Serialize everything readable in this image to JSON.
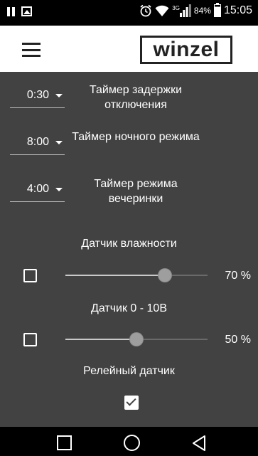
{
  "status_bar": {
    "signal_label": "3G",
    "battery": "84%",
    "time": "15:05",
    "icons": [
      "pause-icon",
      "gallery-icon",
      "alarm-icon",
      "wifi-icon",
      "signal-icon",
      "battery-icon"
    ]
  },
  "app_bar": {
    "logo": "winzel",
    "menu_icon": "hamburger-menu-icon"
  },
  "timers": [
    {
      "value": "0:30",
      "label": "Таймер задержки отключения"
    },
    {
      "value": "8:00",
      "label": "Таймер ночного режима"
    },
    {
      "value": "4:00",
      "label": "Таймер режима вечеринки"
    }
  ],
  "sensors": {
    "humidity": {
      "title": "Датчик влажности",
      "checked": false,
      "value_percent": 70,
      "value_label": "70 %"
    },
    "voltage": {
      "title": "Датчик 0 - 10В",
      "checked": false,
      "value_percent": 50,
      "value_label": "50 %"
    },
    "relay": {
      "title": "Релейный датчик",
      "checked": true
    }
  },
  "nav_bar": {
    "icons": [
      "recents-square-icon",
      "home-circle-icon",
      "back-triangle-icon"
    ]
  },
  "colors": {
    "background": "#424242",
    "app_bar": "#ffffff",
    "system_bars": "#000000",
    "text": "#ffffff"
  }
}
